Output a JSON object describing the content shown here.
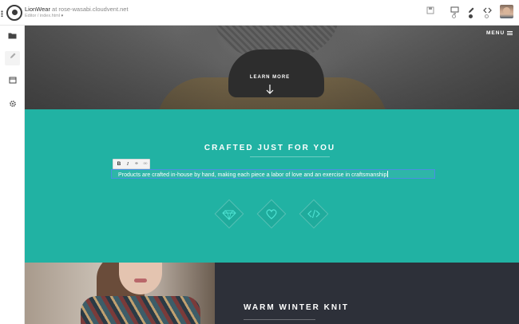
{
  "header": {
    "site_name": "LionWear",
    "site_at": " at ",
    "site_host": "rose-wasabi.cloudvent.net",
    "breadcrumb": "Editor / index.html",
    "breadcrumb_caret": "▾"
  },
  "toolbar": {
    "save_icon": "save-icon",
    "view_icon": "desktop-icon",
    "edit_icon": "pencil-icon",
    "code_icon": "code-icon"
  },
  "sidebar": {
    "items": [
      {
        "icon": "folder-icon",
        "glyph": "▬"
      },
      {
        "icon": "pencil-icon",
        "glyph": "✎"
      },
      {
        "icon": "calendar-icon",
        "glyph": "▦"
      },
      {
        "icon": "gear-icon",
        "glyph": "⚙"
      }
    ]
  },
  "hero": {
    "menu_label": "MENU",
    "learn_more": "LEARN MORE"
  },
  "crafted": {
    "title": "CRAFTED JUST FOR YOU",
    "body": "Products are crafted in-house by hand, making each piece a labor of love and an exercise in craftsmanship",
    "toolbar": {
      "bold": "B",
      "italic": "I",
      "link": "⚭",
      "unlink": "⚮"
    },
    "features": [
      "diamond-icon",
      "heart-icon",
      "code-icon"
    ]
  },
  "knit": {
    "title": "WARM WINTER KNIT"
  },
  "colors": {
    "teal": "#21b2a3",
    "dark": "#2d3039",
    "selection": "#4a90e2",
    "feature_icon": "#4fe3d3"
  }
}
